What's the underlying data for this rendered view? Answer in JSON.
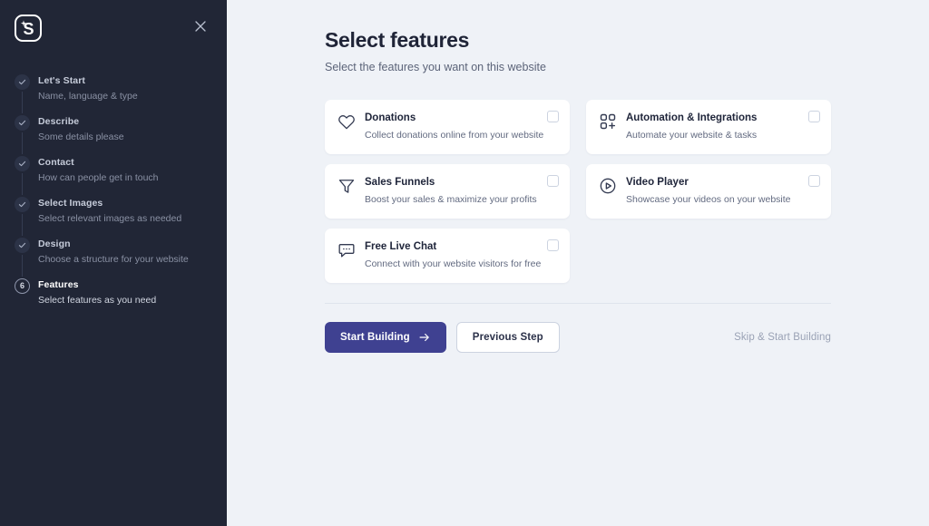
{
  "sidebar": {
    "logo": {
      "icon": "app-logo-s-icon",
      "letter": "S"
    },
    "close": {
      "icon": "close-icon"
    },
    "steps": [
      {
        "id": "lets-start",
        "state": "done",
        "marker": "check",
        "title": "Let's Start",
        "subtitle": "Name, language & type"
      },
      {
        "id": "describe",
        "state": "done",
        "marker": "check",
        "title": "Describe",
        "subtitle": "Some details please"
      },
      {
        "id": "contact",
        "state": "done",
        "marker": "check",
        "title": "Contact",
        "subtitle": "How can people get in touch"
      },
      {
        "id": "select-images",
        "state": "done",
        "marker": "check",
        "title": "Select Images",
        "subtitle": "Select relevant images as needed"
      },
      {
        "id": "design",
        "state": "done",
        "marker": "check",
        "title": "Design",
        "subtitle": "Choose a structure for your website"
      },
      {
        "id": "features",
        "state": "current",
        "marker": "6",
        "title": "Features",
        "subtitle": "Select features as you need"
      }
    ]
  },
  "main": {
    "title": "Select features",
    "subtitle": "Select the features you want on this website",
    "features": [
      {
        "id": "donations",
        "icon": "heart-icon",
        "title": "Donations",
        "subtitle": "Collect donations online from your website",
        "checked": false
      },
      {
        "id": "automation-integrations",
        "icon": "grid-plus-icon",
        "title": "Automation & Integrations",
        "subtitle": "Automate your website & tasks",
        "checked": false
      },
      {
        "id": "sales-funnels",
        "icon": "funnel-icon",
        "title": "Sales Funnels",
        "subtitle": "Boost your sales & maximize your profits",
        "checked": false
      },
      {
        "id": "video-player",
        "icon": "play-circle-icon",
        "title": "Video Player",
        "subtitle": "Showcase your videos on your website",
        "checked": false
      },
      {
        "id": "free-live-chat",
        "icon": "chat-bubble-icon",
        "title": "Free Live Chat",
        "subtitle": "Connect with your website visitors for free",
        "checked": false
      }
    ],
    "actions": {
      "primary_label": "Start Building",
      "primary_icon": "arrow-right-icon",
      "secondary_label": "Previous Step",
      "skip_label": "Skip & Start Building"
    }
  },
  "colors": {
    "sidebar_bg": "#212636",
    "page_bg": "#eff2f7",
    "card_bg": "#ffffff",
    "primary": "#3f4191",
    "title_text": "#1f2437",
    "muted_text": "#626a80",
    "skip_text": "#9aa2b5"
  }
}
